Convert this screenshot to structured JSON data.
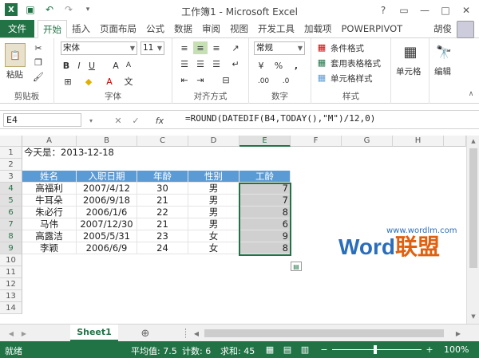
{
  "window": {
    "title": "工作簿1 - Microsoft Excel",
    "user": "胡俊"
  },
  "colors": {
    "accent": "#217346",
    "header_fill": "#5b9bd5",
    "selection": "#d0d0d0"
  },
  "ribbon_tabs": [
    "文件",
    "开始",
    "插入",
    "页面布局",
    "公式",
    "数据",
    "审阅",
    "视图",
    "开发工具",
    "加载项",
    "POWERPIVOT"
  ],
  "ribbon": {
    "clipboard": {
      "label": "剪贴板",
      "paste": "粘贴"
    },
    "font": {
      "label": "字体",
      "name": "宋体",
      "size": "11"
    },
    "alignment": {
      "label": "对齐方式"
    },
    "number": {
      "label": "数字",
      "format": "常规"
    },
    "styles": {
      "label": "样式",
      "cond": "条件格式",
      "table": "套用表格格式",
      "cell": "单元格样式"
    },
    "cells": {
      "label": "单元格"
    },
    "editing": {
      "label": "编辑"
    }
  },
  "formula_bar": {
    "name_box": "E4",
    "fx": "fx",
    "formula": "=ROUND(DATEDIF(B4,TODAY(),\"M\")/12,0)"
  },
  "columns": [
    "A",
    "B",
    "C",
    "D",
    "E",
    "F",
    "G",
    "H"
  ],
  "rows": [
    "1",
    "2",
    "3",
    "4",
    "5",
    "6",
    "7",
    "8",
    "9",
    "10",
    "11",
    "12",
    "13",
    "14"
  ],
  "sheet": {
    "a1": "今天是：2013-12-18",
    "headers": [
      "姓名",
      "入职日期",
      "年龄",
      "性别",
      "工龄"
    ],
    "data": [
      [
        "高福利",
        "2007/4/12",
        "30",
        "男",
        "7"
      ],
      [
        "牛耳朵",
        "2006/9/18",
        "21",
        "男",
        "7"
      ],
      [
        "朱必行",
        "2006/1/6",
        "22",
        "男",
        "8"
      ],
      [
        "马伟",
        "2007/12/30",
        "21",
        "男",
        "6"
      ],
      [
        "高露洁",
        "2005/5/31",
        "23",
        "女",
        "9"
      ],
      [
        "李颖",
        "2006/6/9",
        "24",
        "女",
        "8"
      ]
    ]
  },
  "sheet_tabs": {
    "active": "Sheet1",
    "add": "⊕"
  },
  "status": {
    "ready": "就绪",
    "average": "平均值: 7.5",
    "count": "计数: 6",
    "sum": "求和: 45",
    "zoom": "100%"
  },
  "watermark": {
    "url": "www.wordlm.com",
    "brand_a": "W",
    "brand_b": "ord",
    "brand_c": "联盟"
  }
}
